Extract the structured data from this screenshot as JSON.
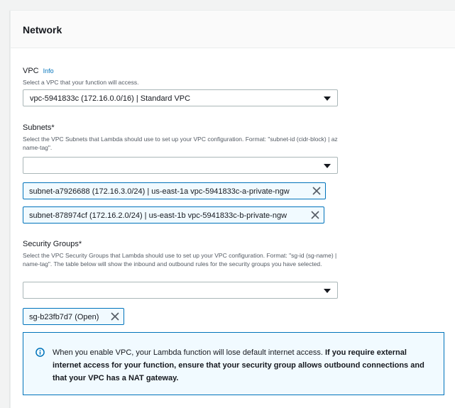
{
  "section": {
    "title": "Network"
  },
  "vpc": {
    "label": "VPC",
    "info": "Info",
    "description": "Select a VPC that your function will access.",
    "selected": "vpc-5941833c (172.16.0.0/16) | Standard VPC"
  },
  "subnets": {
    "label": "Subnets*",
    "description": "Select the VPC Subnets that Lambda should use to set up your VPC configuration. Format: \"subnet-id (cidr-block) | az name-tag\".",
    "selected": "",
    "tokens": [
      "subnet-a7926688 (172.16.3.0/24) | us-east-1a vpc-5941833c-a-private-ngw",
      "subnet-878974cf (172.16.2.0/24) | us-east-1b vpc-5941833c-b-private-ngw"
    ]
  },
  "security_groups": {
    "label": "Security Groups*",
    "description": "Select the VPC Security Groups that Lambda should use to set up your VPC configuration. Format: \"sg-id (sg-name) | name-tag\". The table below will show the inbound and outbound rules for the security groups you have selected.",
    "selected": "",
    "tokens": [
      "sg-b23fb7d7 (Open)"
    ]
  },
  "alert": {
    "text_plain": "When you enable VPC, your Lambda function will lose default internet access. ",
    "text_bold": "If you require external internet access for your function, ensure that your security group allows outbound connections and that your VPC has a NAT gateway."
  },
  "colors": {
    "accent": "#0073bb",
    "alert_bg": "#f1faff",
    "border": "#aab7b8"
  },
  "icons": {
    "caret": "caret-down-icon",
    "remove": "close-icon",
    "info": "info-circle-icon"
  }
}
